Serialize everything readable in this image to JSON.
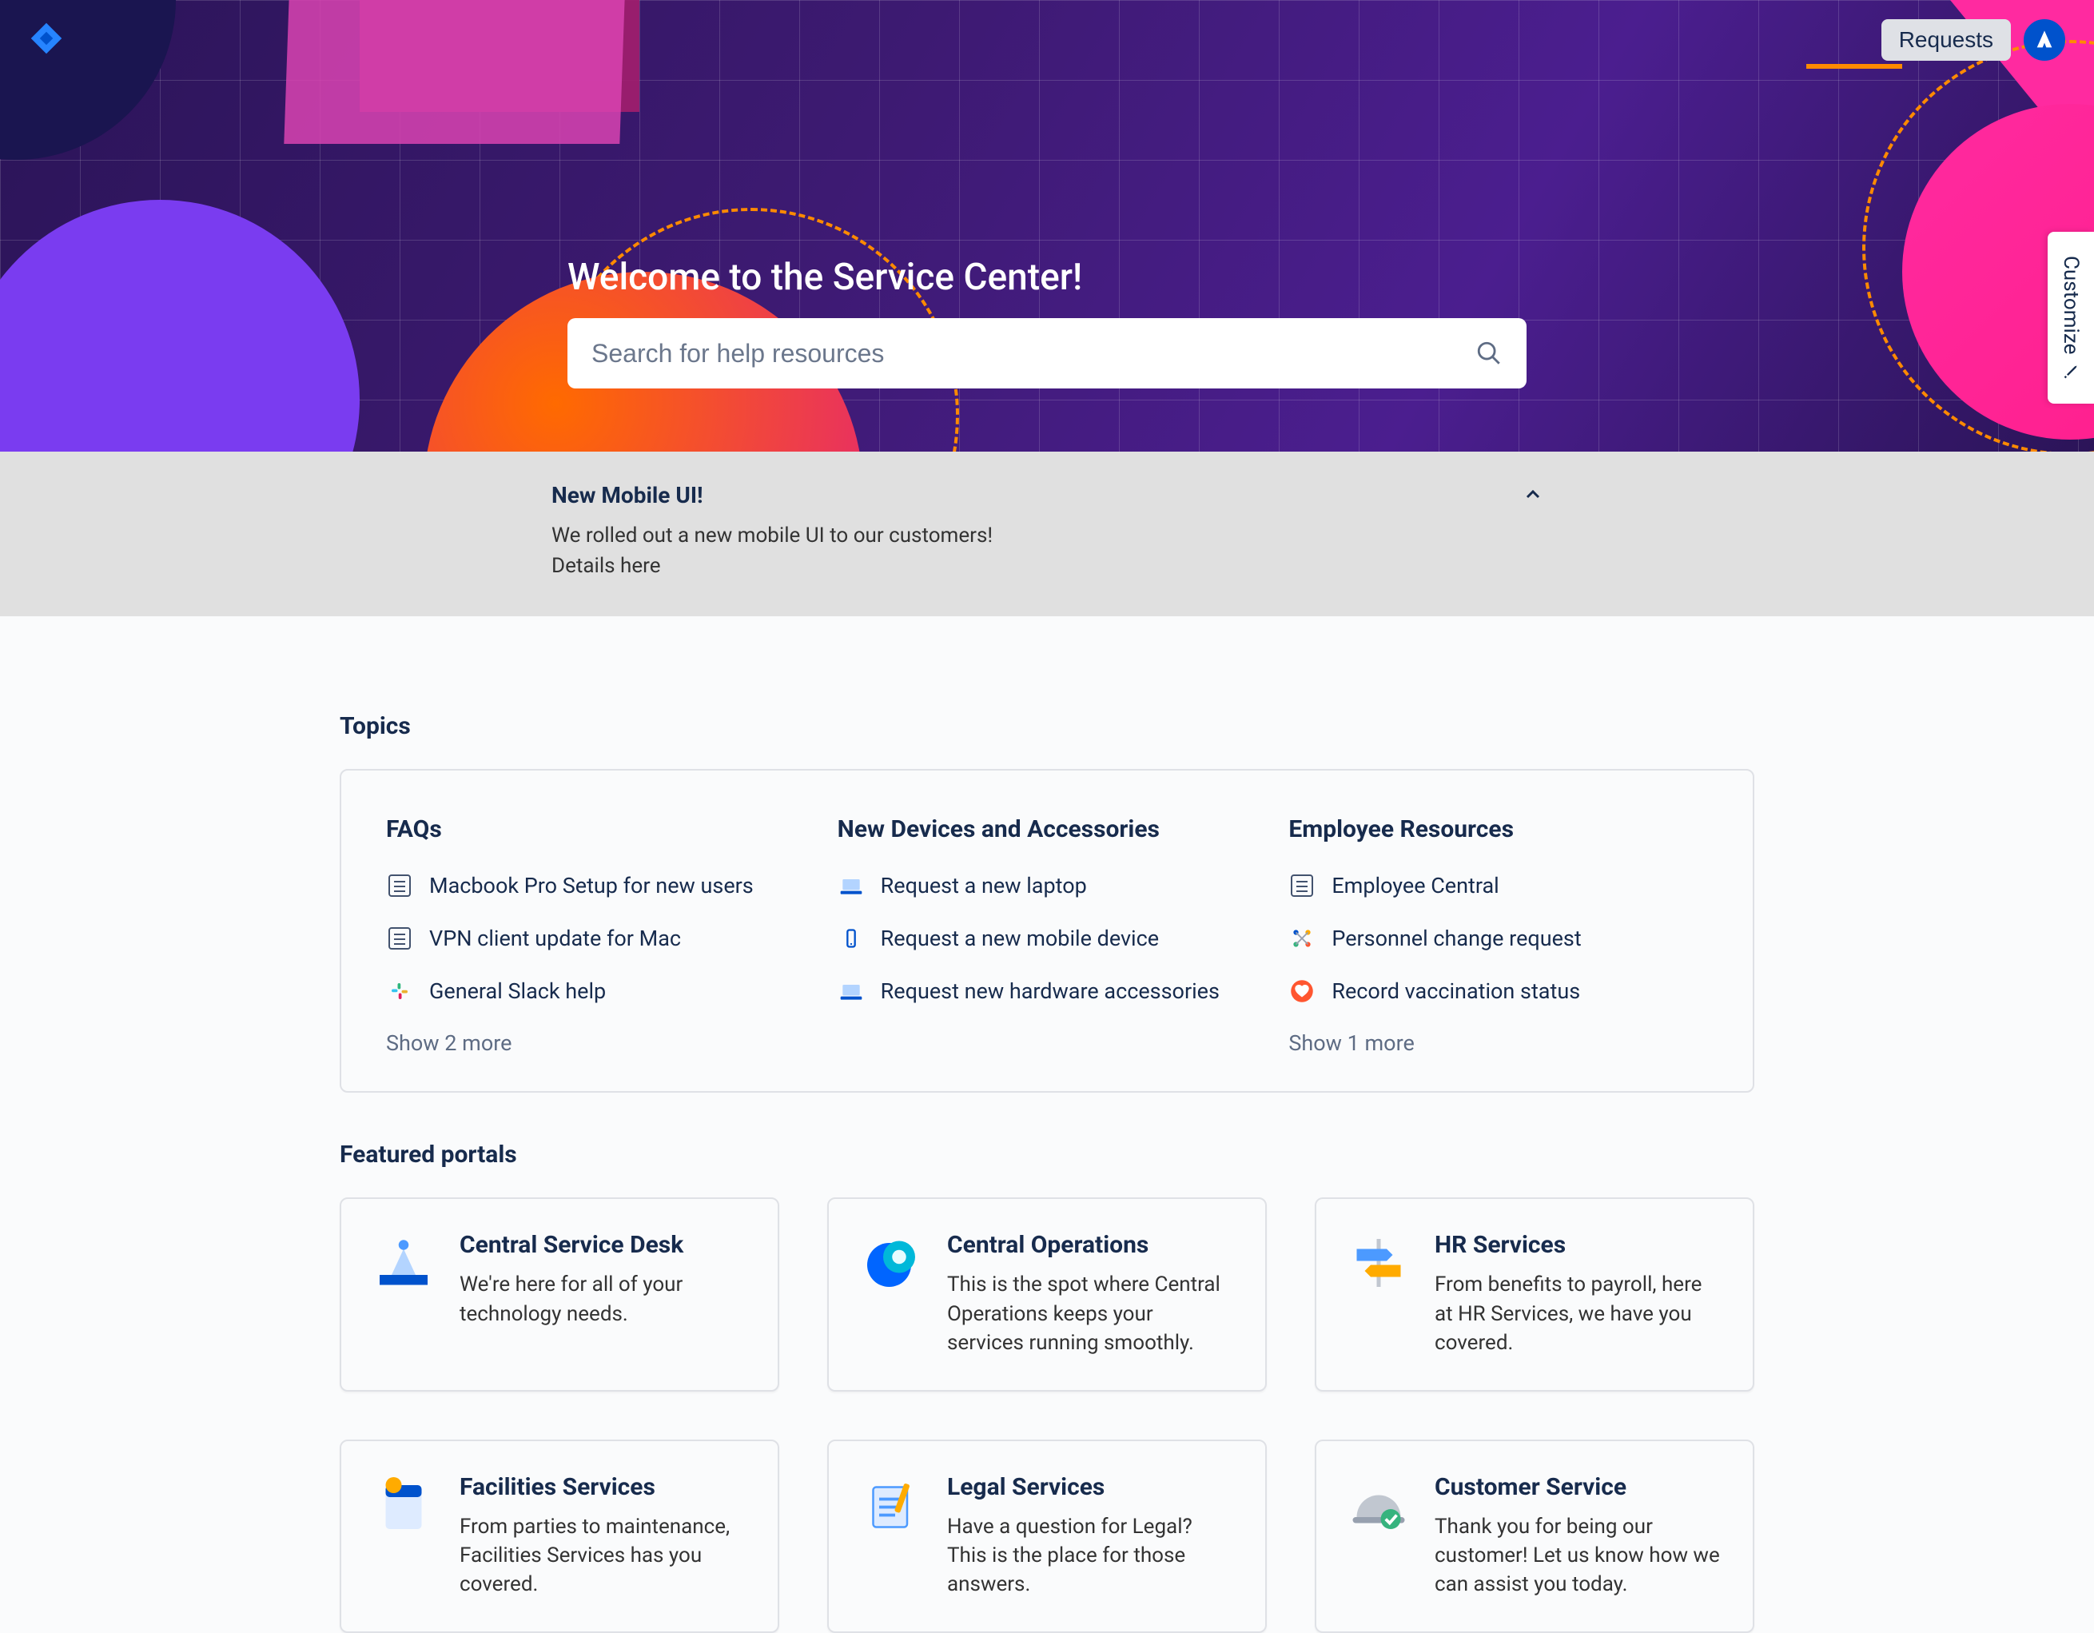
{
  "header": {
    "requests_label": "Requests",
    "customize_label": "Customize"
  },
  "hero": {
    "title": "Welcome to the Service Center!",
    "search_placeholder": "Search for help resources"
  },
  "announcement": {
    "title": "New Mobile UI!",
    "body_line1": "We rolled out a new mobile UI to our customers!",
    "details_link_text": "Details here"
  },
  "topics": {
    "section_label": "Topics",
    "columns": [
      {
        "title": "FAQs",
        "items": [
          "Macbook Pro Setup for new users",
          "VPN client update for Mac",
          "General Slack help"
        ],
        "more_label": "Show 2 more"
      },
      {
        "title": "New Devices and Accessories",
        "items": [
          "Request a new laptop",
          "Request a new mobile device",
          "Request new hardware accessories"
        ],
        "more_label": ""
      },
      {
        "title": "Employee Resources",
        "items": [
          "Employee Central",
          "Personnel change request",
          "Record vaccination status"
        ],
        "more_label": "Show 1 more"
      }
    ]
  },
  "portals": {
    "section_label": "Featured portals",
    "cards": [
      {
        "title": "Central Service Desk",
        "desc": "We're here for all of your technology needs."
      },
      {
        "title": "Central Operations",
        "desc": "This is the spot where Central Operations keeps your services running smoothly."
      },
      {
        "title": "HR Services",
        "desc": "From benefits to payroll, here at HR Services, we have you covered."
      },
      {
        "title": "Facilities Services",
        "desc": "From parties to maintenance, Facilities Services has you covered."
      },
      {
        "title": "Legal Services",
        "desc": "Have a question for Legal? This is the place for those answers."
      },
      {
        "title": "Customer Service",
        "desc": "Thank you for being our customer! Let us know how we can assist you today."
      }
    ]
  }
}
